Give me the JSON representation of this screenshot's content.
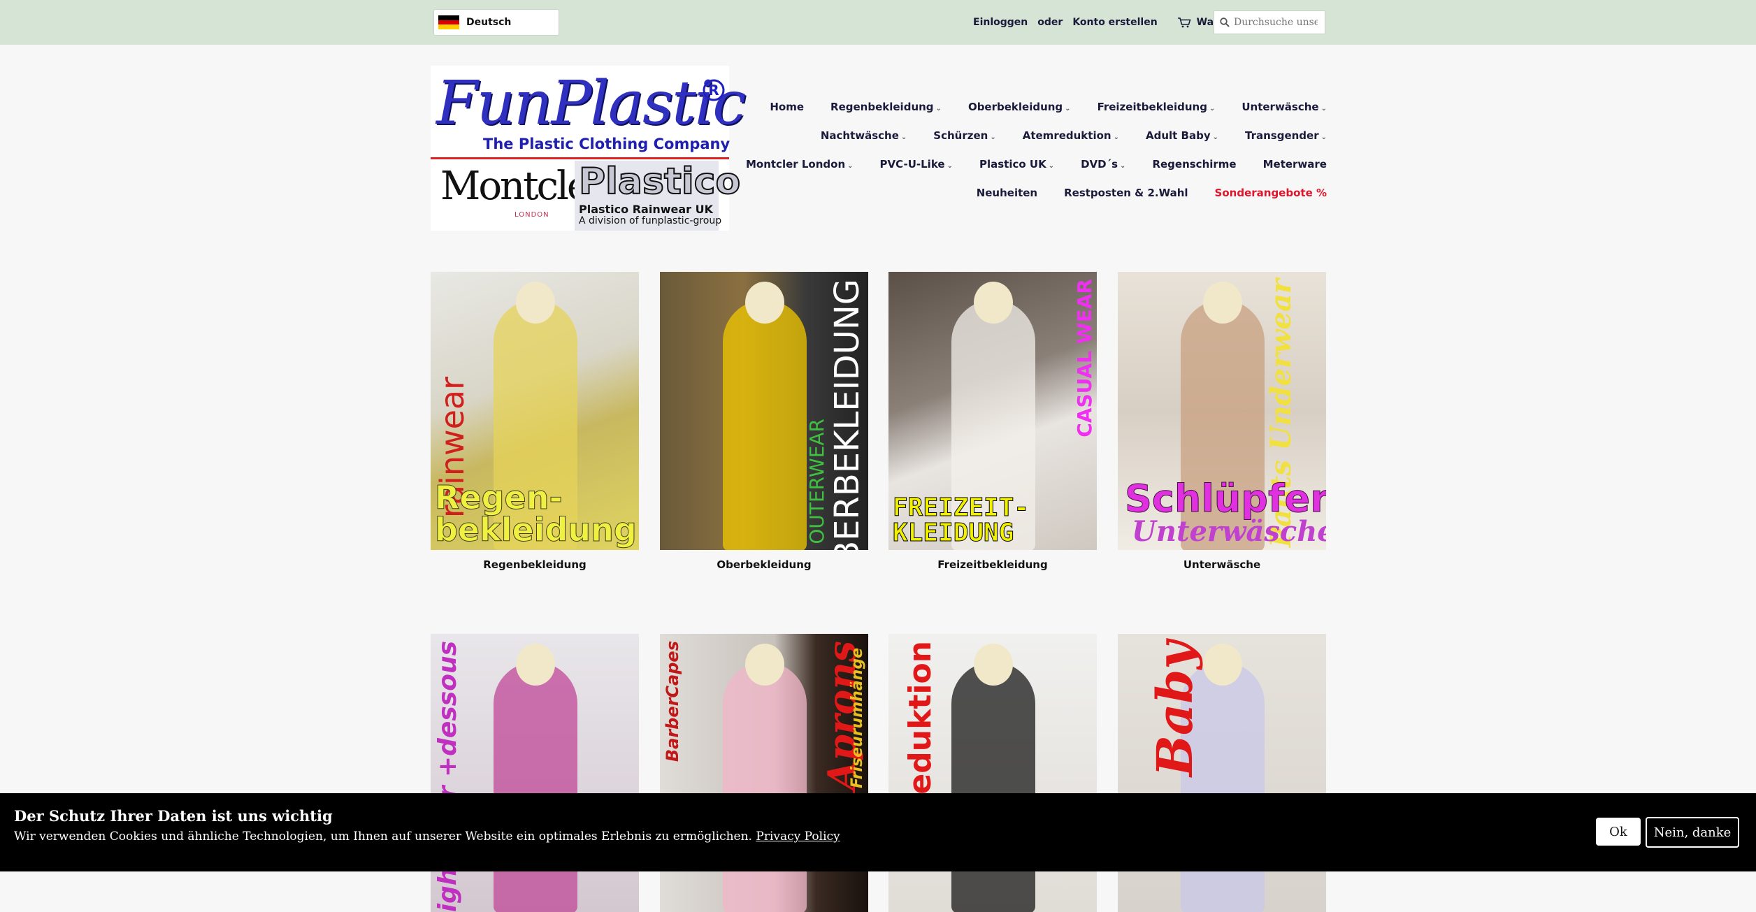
{
  "topbar": {
    "language": "Deutsch",
    "login": "Einloggen",
    "or": "oder",
    "register": "Konto erstellen",
    "cart": "Warenkorb",
    "search_placeholder": "Durchsuche unseren Shop"
  },
  "logo": {
    "brand": "FunPlastic",
    "tagline": "The Plastic Clothing Company",
    "montcler": "Montcler",
    "london": "LONDON",
    "plastico": "Plastico",
    "plastico_sub": "Plastico Rainwear UK",
    "division": "A division of funplastic-group"
  },
  "nav": {
    "rows": [
      [
        {
          "label": "Home",
          "dropdown": false
        },
        {
          "label": "Regenbekleidung",
          "dropdown": true
        },
        {
          "label": "Oberbekleidung",
          "dropdown": true
        },
        {
          "label": "Freizeitbekleidung",
          "dropdown": true
        },
        {
          "label": "Unterwäsche",
          "dropdown": true
        }
      ],
      [
        {
          "label": "Nachtwäsche",
          "dropdown": true
        },
        {
          "label": "Schürzen",
          "dropdown": true
        },
        {
          "label": "Atemreduktion",
          "dropdown": true
        },
        {
          "label": "Adult Baby",
          "dropdown": true
        },
        {
          "label": "Transgender",
          "dropdown": true
        }
      ],
      [
        {
          "label": "Montcler London",
          "dropdown": true
        },
        {
          "label": "PVC-U-Like",
          "dropdown": true
        },
        {
          "label": "Plastico UK",
          "dropdown": true
        },
        {
          "label": "DVD´s",
          "dropdown": true
        },
        {
          "label": "Regenschirme",
          "dropdown": false
        },
        {
          "label": "Meterware",
          "dropdown": false
        }
      ],
      [
        {
          "label": "Neuheiten",
          "dropdown": false
        },
        {
          "label": "Restposten & 2.Wahl",
          "dropdown": false
        },
        {
          "label": "Sonderangebote %",
          "dropdown": false,
          "highlight": true
        }
      ]
    ]
  },
  "collections": [
    {
      "caption": "Regenbekleidung",
      "overlay_vertical": "rainwear",
      "overlay_main": "Regen-\nbekleidung"
    },
    {
      "caption": "Oberbekleidung",
      "overlay_vertical": "OBERBEKLEIDUNG",
      "overlay_small": "OUTERWEAR"
    },
    {
      "caption": "Freizeitbekleidung",
      "overlay_vertical": "CASUAL WEAR",
      "overlay_main": "FREIZEIT-\nKLEIDUNG"
    },
    {
      "caption": "Unterwäsche",
      "overlay_vertical": "Pants Underwear",
      "overlay_main": "Schlüpfer",
      "overlay_sub": "Unterwäsche"
    },
    {
      "caption": "",
      "overlay_vertical": "Nightwear +dessous"
    },
    {
      "caption": "",
      "overlay_vertical": "Aprons",
      "overlay_small": "BarberCapes",
      "overlay_extra": "Friseurumhänge"
    },
    {
      "caption": "",
      "overlay_vertical": "reduktion"
    },
    {
      "caption": "",
      "overlay_vertical": "Baby"
    }
  ],
  "cookie": {
    "title": "Der Schutz Ihrer Daten ist uns wichtig",
    "text": "Wir verwenden Cookies und ähnliche Technologien, um Ihnen auf unserer Website ein optimales Erlebnis zu ermöglichen.",
    "privacy_link": "Privacy Policy",
    "ok": "Ok",
    "decline": "Nein, danke"
  },
  "colors": {
    "topbar_bg": "#d6e4d6",
    "page_bg": "#f7f7f7",
    "nav_text": "#1a1a3a",
    "sale": "#e0142a",
    "cookie_bg": "#000000"
  }
}
